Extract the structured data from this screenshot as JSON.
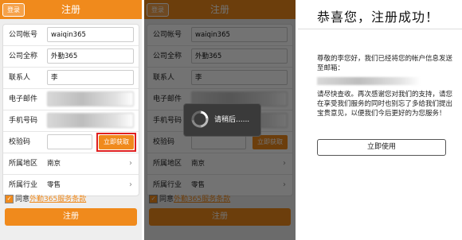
{
  "header": {
    "back_label": "登录",
    "title": "注册"
  },
  "form": {
    "company_account_label": "公司帐号",
    "company_account_value": "waiqin365",
    "company_name_label": "公司全称",
    "company_name_value": "外勤365",
    "contact_label": "联系人",
    "contact_value": "李",
    "email_label": "电子邮件",
    "phone_label": "手机号码",
    "code_label": "校验码",
    "get_code_label": "立即获取",
    "region_label": "所属地区",
    "region_value": "南京",
    "industry_label": "所属行业",
    "industry_value": "零售"
  },
  "agree": {
    "prefix": "同意",
    "link": "外勤365服务条款"
  },
  "submit_label": "注册",
  "loading_text": "请稍后......",
  "success": {
    "title": "恭喜您，注册成功！",
    "message1": "尊敬的李您好，我们已经将您的帐户信息发送至邮箱：",
    "message2": "请尽快查收。再次感谢您对我们的支持，请您在享受我们服务的同时也别忘了多给我们提出宝贵意见，以便我们今后更好的为您服务！",
    "button": "立即使用"
  },
  "colors": {
    "accent": "#f08a1c",
    "highlight": "#e02020"
  }
}
